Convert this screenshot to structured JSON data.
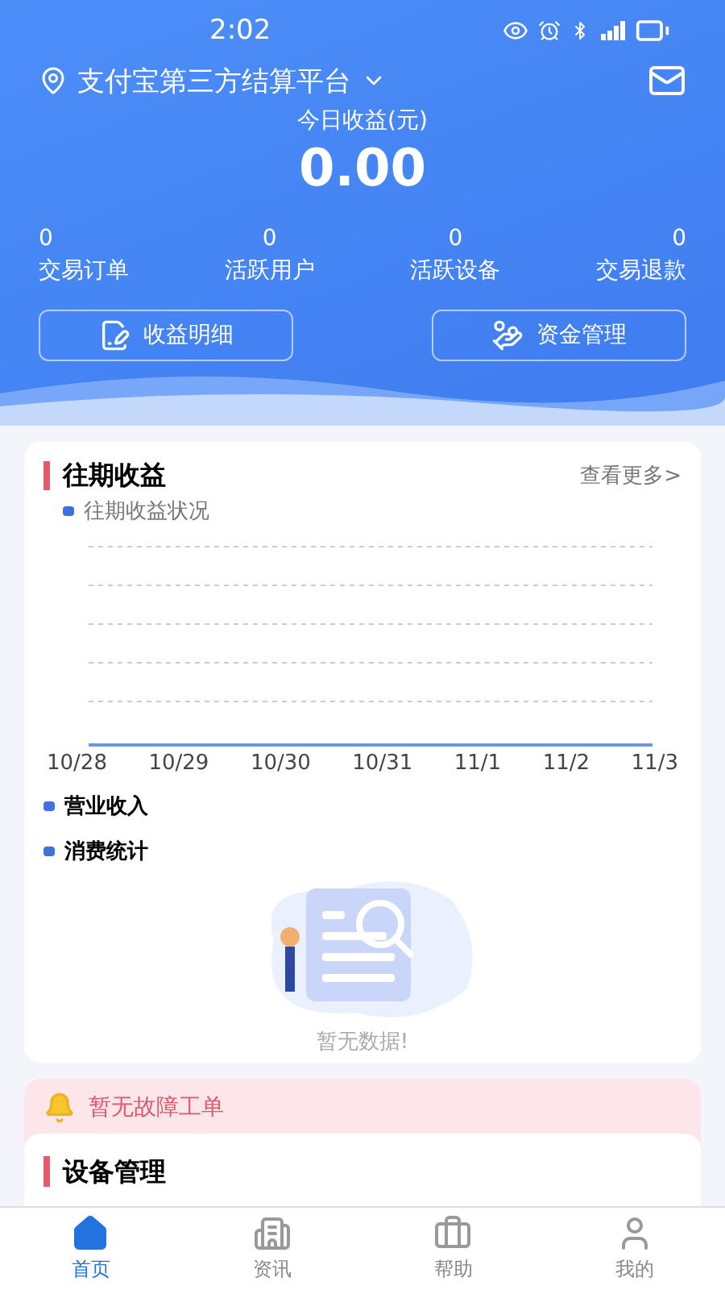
{
  "status_bar": {
    "time": "2:02"
  },
  "header": {
    "location": "支付宝第三方结算平台",
    "today_label": "今日收益(元)",
    "today_value": "0.00"
  },
  "stats": [
    {
      "value": "0",
      "label": "交易订单"
    },
    {
      "value": "0",
      "label": "活跃用户"
    },
    {
      "value": "0",
      "label": "活跃设备"
    },
    {
      "value": "0",
      "label": "交易退款"
    }
  ],
  "actions": [
    {
      "label": "收益明细",
      "kind": "detail"
    },
    {
      "label": "资金管理",
      "kind": "funds"
    }
  ],
  "income_card": {
    "title": "往期收益",
    "more": "查看更多>",
    "chart": {
      "legend": "往期收益状况",
      "x_labels": [
        "10/28",
        "10/29",
        "10/30",
        "10/31",
        "11/1",
        "11/2",
        "11/3"
      ]
    },
    "legend_items": [
      {
        "label": "营业收入"
      },
      {
        "label": "消费统计"
      }
    ],
    "empty_text": "暂无数据!"
  },
  "alert": {
    "text": "暂无故障工单"
  },
  "device_card": {
    "title": "设备管理"
  },
  "tab_bar": [
    {
      "label": "首页",
      "kind": "home",
      "selected": true
    },
    {
      "label": "资讯",
      "kind": "news",
      "selected": false
    },
    {
      "label": "帮助",
      "kind": "help",
      "selected": false
    },
    {
      "label": "我的",
      "kind": "profile",
      "selected": false
    }
  ]
}
